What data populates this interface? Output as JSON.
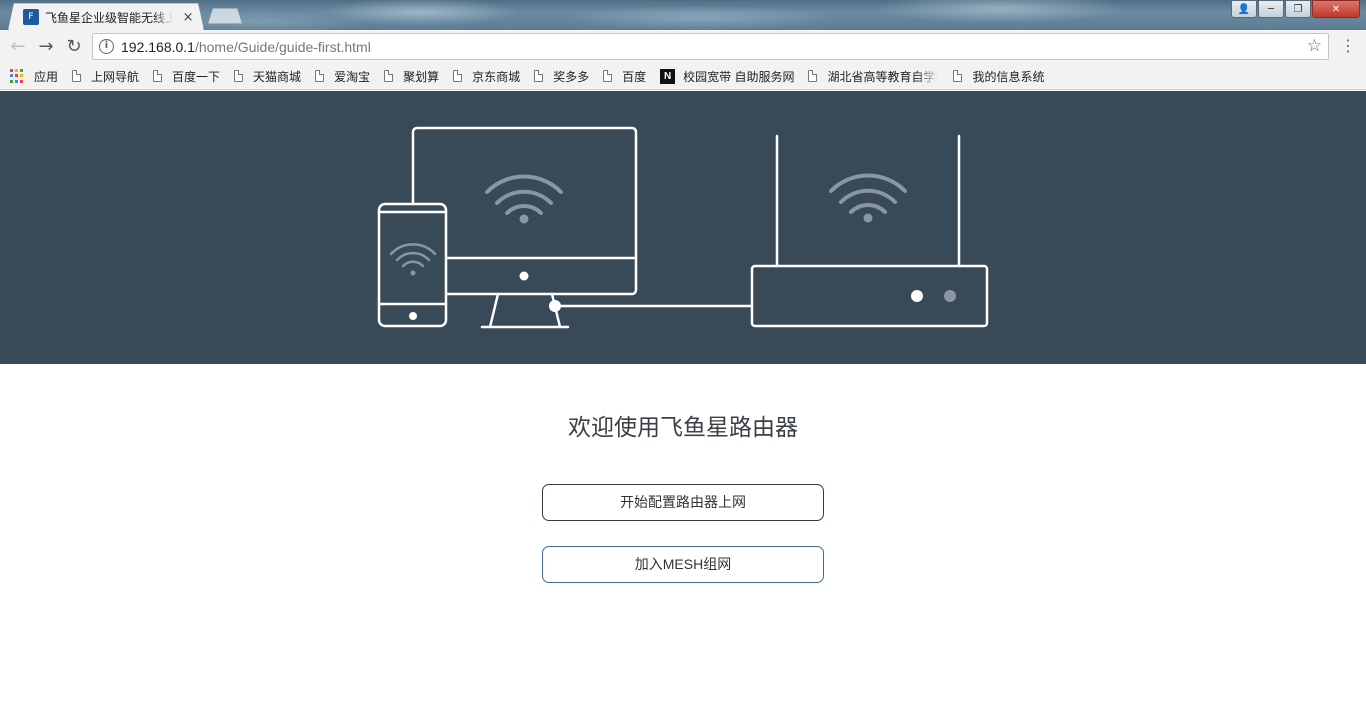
{
  "browser": {
    "tab_title": "飞鱼星企业级智能无线上网行为管理路由器",
    "tab_favicon_text": "F",
    "tab_close": "×",
    "url_host": "192.168.0.1",
    "url_path": "/home/Guide/guide-first.html",
    "info_glyph": "i",
    "star_glyph": "☆",
    "menu_glyph": "⋮",
    "back_glyph": "←",
    "forward_glyph": "→",
    "reload_glyph": "↻",
    "window_buttons": {
      "user": "👤",
      "minimize": "─",
      "maximize": "❐",
      "close": "✕"
    }
  },
  "bookmarks": [
    {
      "label": "应用",
      "icon": "apps-icon"
    },
    {
      "label": "上网导航",
      "icon": "page-icon"
    },
    {
      "label": "百度一下",
      "icon": "page-icon"
    },
    {
      "label": "天猫商城",
      "icon": "page-icon"
    },
    {
      "label": "爱淘宝",
      "icon": "page-icon"
    },
    {
      "label": "聚划算",
      "icon": "page-icon"
    },
    {
      "label": "京东商城",
      "icon": "page-icon"
    },
    {
      "label": "奖多多",
      "icon": "page-icon"
    },
    {
      "label": "百度",
      "icon": "page-icon"
    },
    {
      "label": "校园宽带 自助服务网",
      "icon": "n-icon",
      "icon_text": "N"
    },
    {
      "label": "湖北省高等教育自学考试",
      "icon": "page-icon"
    },
    {
      "label": "我的信息系统",
      "icon": "page-icon"
    }
  ],
  "page": {
    "welcome": "欢迎使用飞鱼星路由器",
    "start_button": "开始配置路由器上网",
    "mesh_button": "加入MESH组网"
  },
  "colors": {
    "hero_background": "#384958",
    "illustration_stroke": "#ffffff",
    "wifi_icon": "#8a96a1",
    "start_button_border": "#2f3a45",
    "mesh_button_border": "#3d6f95"
  }
}
